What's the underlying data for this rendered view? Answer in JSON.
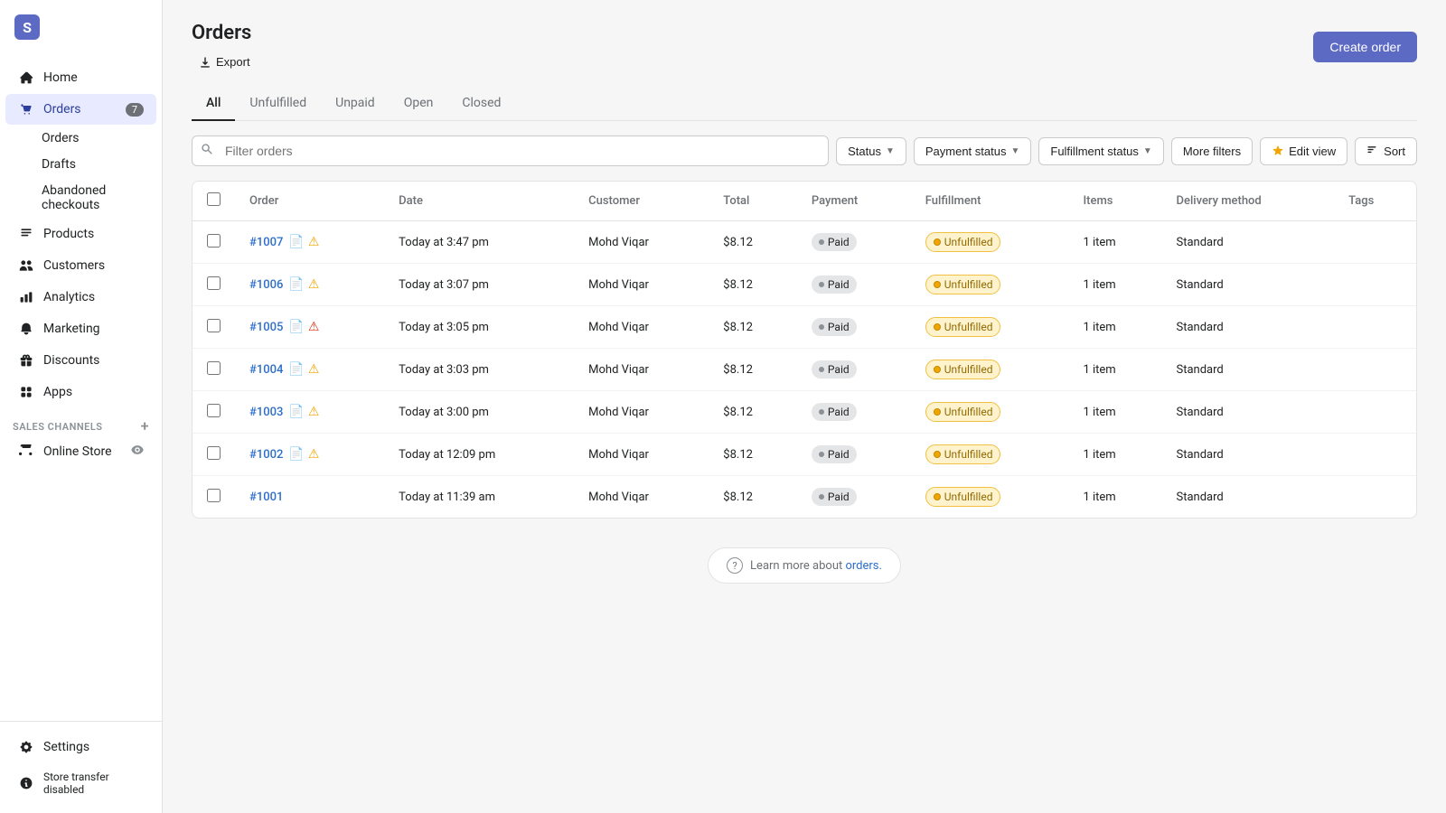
{
  "sidebar": {
    "logo_text": "S",
    "nav_items": [
      {
        "id": "home",
        "label": "Home",
        "icon": "home"
      },
      {
        "id": "orders",
        "label": "Orders",
        "icon": "orders",
        "badge": "7",
        "active": true
      },
      {
        "id": "products",
        "label": "Products",
        "icon": "products"
      },
      {
        "id": "customers",
        "label": "Customers",
        "icon": "customers"
      },
      {
        "id": "analytics",
        "label": "Analytics",
        "icon": "analytics"
      },
      {
        "id": "marketing",
        "label": "Marketing",
        "icon": "marketing"
      },
      {
        "id": "discounts",
        "label": "Discounts",
        "icon": "discounts"
      },
      {
        "id": "apps",
        "label": "Apps",
        "icon": "apps"
      }
    ],
    "orders_sub": [
      {
        "id": "orders-main",
        "label": "Orders",
        "active": true
      },
      {
        "id": "drafts",
        "label": "Drafts"
      },
      {
        "id": "abandoned",
        "label": "Abandoned checkouts"
      }
    ],
    "sales_channels_label": "SALES CHANNELS",
    "sales_channels": [
      {
        "id": "online-store",
        "label": "Online Store"
      }
    ],
    "settings_label": "Settings",
    "store_transfer_label": "Store transfer disabled"
  },
  "page": {
    "title": "Orders",
    "create_order_label": "Create order",
    "export_label": "Export"
  },
  "tabs": [
    {
      "id": "all",
      "label": "All",
      "active": true
    },
    {
      "id": "unfulfilled",
      "label": "Unfulfilled"
    },
    {
      "id": "unpaid",
      "label": "Unpaid"
    },
    {
      "id": "open",
      "label": "Open"
    },
    {
      "id": "closed",
      "label": "Closed"
    }
  ],
  "filters": {
    "search_placeholder": "Filter orders",
    "status_label": "Status",
    "payment_status_label": "Payment status",
    "fulfillment_status_label": "Fulfillment status",
    "more_filters_label": "More filters",
    "edit_view_label": "Edit view",
    "sort_label": "Sort"
  },
  "table": {
    "columns": [
      "",
      "Order",
      "Date",
      "Customer",
      "Total",
      "Payment",
      "Fulfillment",
      "Items",
      "Delivery method",
      "Tags"
    ],
    "rows": [
      {
        "id": "#1007",
        "date": "Today at 3:47 pm",
        "customer": "Mohd Viqar",
        "total": "$8.12",
        "payment": "Paid",
        "fulfillment": "Unfulfilled",
        "items": "1 item",
        "delivery": "Standard",
        "has_doc": true,
        "has_warn": true,
        "warn_red": false
      },
      {
        "id": "#1006",
        "date": "Today at 3:07 pm",
        "customer": "Mohd Viqar",
        "total": "$8.12",
        "payment": "Paid",
        "fulfillment": "Unfulfilled",
        "items": "1 item",
        "delivery": "Standard",
        "has_doc": true,
        "has_warn": true,
        "warn_red": false
      },
      {
        "id": "#1005",
        "date": "Today at 3:05 pm",
        "customer": "Mohd Viqar",
        "total": "$8.12",
        "payment": "Paid",
        "fulfillment": "Unfulfilled",
        "items": "1 item",
        "delivery": "Standard",
        "has_doc": true,
        "has_warn": true,
        "warn_red": true
      },
      {
        "id": "#1004",
        "date": "Today at 3:03 pm",
        "customer": "Mohd Viqar",
        "total": "$8.12",
        "payment": "Paid",
        "fulfillment": "Unfulfilled",
        "items": "1 item",
        "delivery": "Standard",
        "has_doc": true,
        "has_warn": true,
        "warn_red": false
      },
      {
        "id": "#1003",
        "date": "Today at 3:00 pm",
        "customer": "Mohd Viqar",
        "total": "$8.12",
        "payment": "Paid",
        "fulfillment": "Unfulfilled",
        "items": "1 item",
        "delivery": "Standard",
        "has_doc": true,
        "has_warn": true,
        "warn_red": false
      },
      {
        "id": "#1002",
        "date": "Today at 12:09 pm",
        "customer": "Mohd Viqar",
        "total": "$8.12",
        "payment": "Paid",
        "fulfillment": "Unfulfilled",
        "items": "1 item",
        "delivery": "Standard",
        "has_doc": true,
        "has_warn": true,
        "warn_red": false
      },
      {
        "id": "#1001",
        "date": "Today at 11:39 am",
        "customer": "Mohd Viqar",
        "total": "$8.12",
        "payment": "Paid",
        "fulfillment": "Unfulfilled",
        "items": "1 item",
        "delivery": "Standard",
        "has_doc": false,
        "has_warn": false,
        "warn_red": false
      }
    ]
  },
  "learn_more": {
    "text": "Learn more about",
    "link_label": "orders.",
    "link_href": "#"
  }
}
